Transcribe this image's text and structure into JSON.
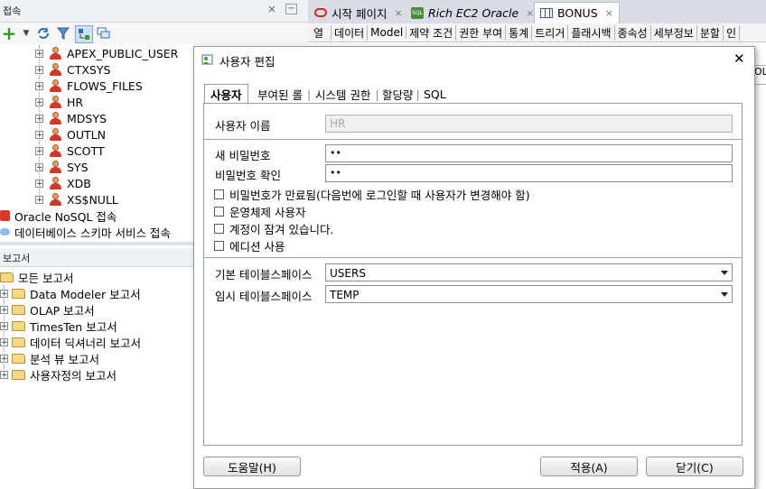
{
  "connections_panel": {
    "title": "접속",
    "close_glyph": "×",
    "minimize_glyph": "−",
    "tree_users": [
      "APEX_PUBLIC_USER",
      "CTXSYS",
      "FLOWS_FILES",
      "HR",
      "MDSYS",
      "OUTLN",
      "SCOTT",
      "SYS",
      "XDB",
      "XS$NULL"
    ],
    "tree_other": [
      "Oracle NoSQL 접속",
      "데이터베이스 스키마 서비스 접속"
    ]
  },
  "reports_panel": {
    "title": "보고서",
    "root": "모든 보고서",
    "items": [
      "Data Modeler 보고서",
      "OLAP 보고서",
      "TimesTen 보고서",
      "데이터 딕셔너리 보고서",
      "분석 뷰 보고서",
      "사용자정의 보고서"
    ]
  },
  "doc_tabs": [
    {
      "label": "시작 페이지",
      "icon": "oracle-icon"
    },
    {
      "label": "Rich EC2 Oracle",
      "icon": "sql-icon"
    },
    {
      "label": "BONUS",
      "icon": "table-icon"
    }
  ],
  "doc_tab_close": "×",
  "sub_tabs": [
    "열",
    "데이터",
    "Model",
    "제약 조건",
    "권한 부여",
    "통계",
    "트리거",
    "플래시백",
    "종속성",
    "세부정보",
    "분할",
    "인"
  ],
  "right_fragment": "OLL",
  "dialog": {
    "title": "사용자 편집",
    "close_glyph": "✕",
    "tabs": [
      "사용자",
      "부여된 롤",
      "시스템 권한",
      "할당량",
      "SQL"
    ],
    "active_tab": "사용자",
    "username_label": "사용자 이름",
    "username_value": "HR",
    "new_password_label": "새 비밀번호",
    "new_password_value": "••",
    "confirm_password_label": "비밀번호 확인",
    "confirm_password_value": "••",
    "checkboxes": [
      "비밀번호가 만료됨(다음번에 로그인할 때 사용자가 변경해야 함)",
      "운영체제 사용자",
      "계정이 잠겨 있습니다.",
      "에디션 사용"
    ],
    "default_tablespace_label": "기본 테이블스페이스",
    "default_tablespace_value": "USERS",
    "temp_tablespace_label": "임시 테이블스페이스",
    "temp_tablespace_value": "TEMP",
    "help_button": "도움말(H)",
    "apply_button": "적용(A)",
    "close_button": "닫기(C)"
  }
}
